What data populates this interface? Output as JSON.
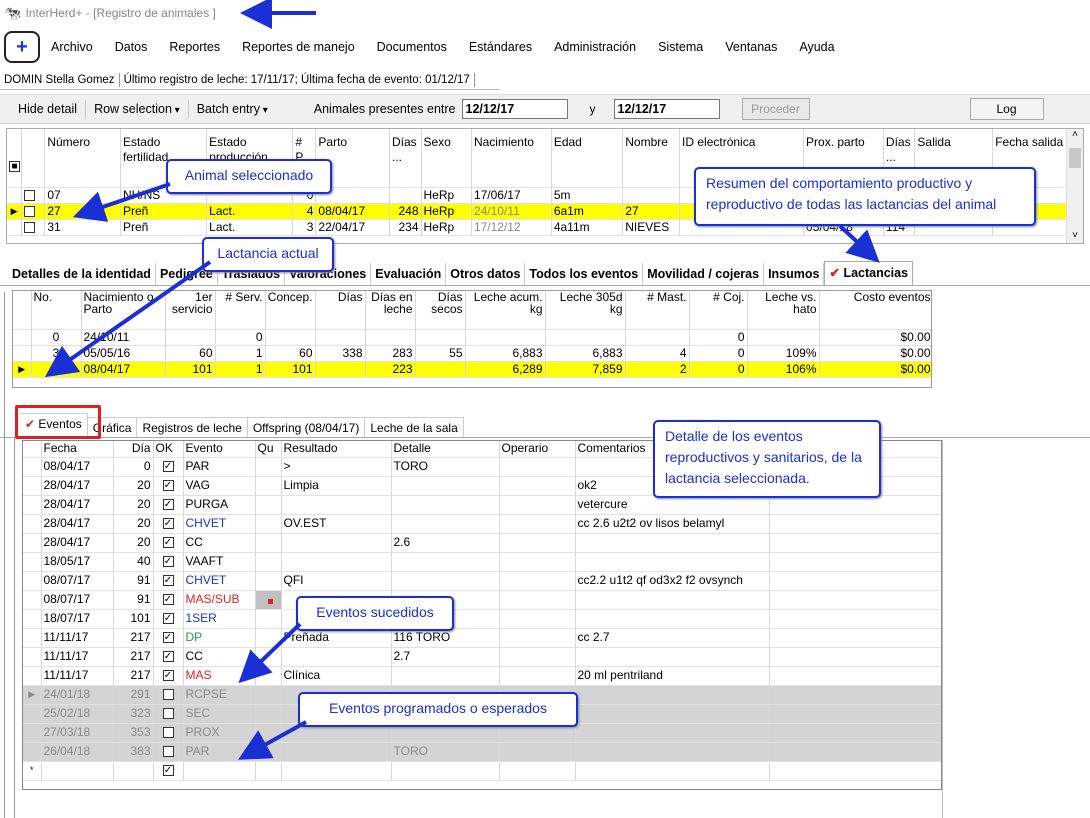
{
  "window": {
    "title": "InterHerd+ - [Registro de animales ]"
  },
  "menu": [
    "Archivo",
    "Datos",
    "Reportes",
    "Reportes de manejo",
    "Documentos",
    "Estándares",
    "Administración",
    "Sistema",
    "Ventanas",
    "Ayuda"
  ],
  "status": {
    "user": "DOMIN Stella Gomez",
    "info": "Último registro de leche: 17/11/17; Última fecha de evento: 01/12/17"
  },
  "toolbar": {
    "hide_detail": "Hide detail",
    "row_selection": "Row selection",
    "batch_entry": "Batch entry",
    "animals_between": "Animales presentes entre",
    "date_from": "12/12/17",
    "and": "y",
    "date_to": "12/12/17",
    "proceed": "Proceder",
    "log": "Log"
  },
  "animals": {
    "headers": [
      "Número",
      "Estado fertilidad",
      "Estado producción",
      "# P.",
      "Parto",
      "Días ...",
      "Sexo",
      "Nacimiento",
      "Edad",
      "Nombre",
      "ID electrónica",
      "Prox. parto",
      "Días ...",
      "Salida",
      "Fecha salida"
    ],
    "rows": [
      [
        "07",
        "NH/NS",
        "",
        "0",
        "",
        "",
        "HeRp",
        "17/06/17",
        "5m",
        "",
        "",
        "",
        "",
        "",
        ""
      ],
      [
        "27",
        "Preñ",
        "Lact.",
        "4",
        "08/04/17",
        "248",
        "HeRp",
        "24/10/11",
        "6a1m",
        "27",
        "",
        "",
        "",
        "",
        ""
      ],
      [
        "31",
        "Preñ",
        "Lact.",
        "3",
        "22/04/17",
        "234",
        "HeRp",
        "17/12/12",
        "4a11m",
        "NIEVES",
        "",
        "05/04/18",
        "114",
        "",
        ""
      ]
    ]
  },
  "tabs": [
    "Detalles de la identidad",
    "Pedigree",
    "Traslados",
    "Valoraciones",
    "Evaluación",
    "Otros datos",
    "Todos los eventos",
    "Movilidad / cojeras",
    "Insumos",
    "Lactancias"
  ],
  "lactations": {
    "headers": [
      "No.",
      "Nacimiento o Parto",
      "1er servicio",
      "# Serv.",
      "Concep.",
      "Días",
      "Días en leche",
      "Días secos",
      "Leche acum. kg",
      "Leche 305d kg",
      "# Mast.",
      "# Coj.",
      "Leche vs. hato",
      "Costo eventos"
    ],
    "rows": [
      [
        "0",
        "24/10/11",
        "",
        "0",
        "",
        "",
        "",
        "",
        "",
        "",
        "",
        "0",
        "",
        "$0.00"
      ],
      [
        "3",
        "05/05/16",
        "60",
        "1",
        "60",
        "338",
        "283",
        "55",
        "6,883",
        "6,883",
        "4",
        "0",
        "109%",
        "$0.00"
      ],
      [
        "4",
        "08/04/17",
        "101",
        "1",
        "101",
        "",
        "223",
        "",
        "6,289",
        "7,859",
        "2",
        "0",
        "106%",
        "$0.00"
      ]
    ]
  },
  "subtabs": [
    "Eventos",
    "Gráfica",
    "Registros de leche",
    "Offspring (08/04/17)",
    "Leche de la sala"
  ],
  "events": {
    "headers": [
      "Fecha",
      "Día",
      "OK",
      "Evento",
      "Qu",
      "Resultado",
      "Detalle",
      "Operario",
      "Comentarios",
      "...tal"
    ],
    "rows": [
      {
        "f": "08/04/17",
        "d": "0",
        "ok": true,
        "e": "PAR",
        "c": "",
        "r": ">",
        "det": "TORO",
        "com": "",
        "st": ""
      },
      {
        "f": "28/04/17",
        "d": "20",
        "ok": true,
        "e": "VAG",
        "c": "",
        "r": "Limpia",
        "det": "",
        "com": "ok2",
        "st": ""
      },
      {
        "f": "28/04/17",
        "d": "20",
        "ok": true,
        "e": "PURGA",
        "c": "",
        "r": "",
        "det": "",
        "com": "vetercure",
        "st": ""
      },
      {
        "f": "28/04/17",
        "d": "20",
        "ok": true,
        "e": "CHVET",
        "c": "blue",
        "r": "OV.EST",
        "det": "",
        "com": "cc 2.6 u2t2 ov lisos belamyl",
        "st": ""
      },
      {
        "f": "28/04/17",
        "d": "20",
        "ok": true,
        "e": "CC",
        "c": "",
        "r": "",
        "det": "2.6",
        "com": "",
        "st": ""
      },
      {
        "f": "18/05/17",
        "d": "40",
        "ok": true,
        "e": "VAAFT",
        "c": "",
        "r": "",
        "det": "",
        "com": "",
        "st": ""
      },
      {
        "f": "08/07/17",
        "d": "91",
        "ok": true,
        "e": "CHVET",
        "c": "blue",
        "r": "QFI",
        "det": "",
        "com": "cc2.2 u1t2 qf od3x2 f2 ovsynch",
        "st": ""
      },
      {
        "f": "08/07/17",
        "d": "91",
        "ok": true,
        "e": "MAS/SUB",
        "c": "red",
        "r": "",
        "det": "",
        "com": "",
        "st": ""
      },
      {
        "f": "18/07/17",
        "d": "101",
        "ok": true,
        "e": "1SER",
        "c": "blue",
        "r": "",
        "det": "...1)",
        "com": "",
        "st": ""
      },
      {
        "f": "11/11/17",
        "d": "217",
        "ok": true,
        "e": "DP",
        "c": "green",
        "r": "Preñada",
        "det": "116 TORO",
        "com": "cc 2.7",
        "st": ""
      },
      {
        "f": "11/11/17",
        "d": "217",
        "ok": true,
        "e": "CC",
        "c": "",
        "r": "",
        "det": "2.7",
        "com": "",
        "st": ""
      },
      {
        "f": "11/11/17",
        "d": "217",
        "ok": true,
        "e": "MAS",
        "c": "red",
        "r": "Clínica",
        "det": "",
        "com": "20 ml pentriland",
        "st": ""
      },
      {
        "f": "24/01/18",
        "d": "291",
        "ok": false,
        "e": "RCPSE",
        "c": "",
        "r": "",
        "det": "",
        "com": "",
        "st": "gray"
      },
      {
        "f": "25/02/18",
        "d": "323",
        "ok": false,
        "e": "SEC",
        "c": "",
        "r": "",
        "det": "",
        "com": "",
        "st": "gray"
      },
      {
        "f": "27/03/18",
        "d": "353",
        "ok": false,
        "e": "PROX",
        "c": "",
        "r": "",
        "det": "",
        "com": "",
        "st": "gray"
      },
      {
        "f": "26/04/18",
        "d": "383",
        "ok": false,
        "e": "PAR",
        "c": "",
        "r": "",
        "det": "TORO",
        "com": "",
        "st": "gray"
      }
    ]
  },
  "callouts": {
    "animal": "Animal seleccionado",
    "summary": "Resumen del comportamiento productivo y reproductivo de todas las lactancias del animal",
    "lactation": "Lactancia actual",
    "detail": "Detalle de los eventos reproductivos y sanitarios, de la lactancia seleccionada.",
    "occurred": "Eventos sucedidos",
    "scheduled": "Eventos programados o esperados"
  },
  "colors": {
    "highlight": "#ffff00",
    "callout": "#1a2fd6",
    "frame": "#e02020"
  }
}
